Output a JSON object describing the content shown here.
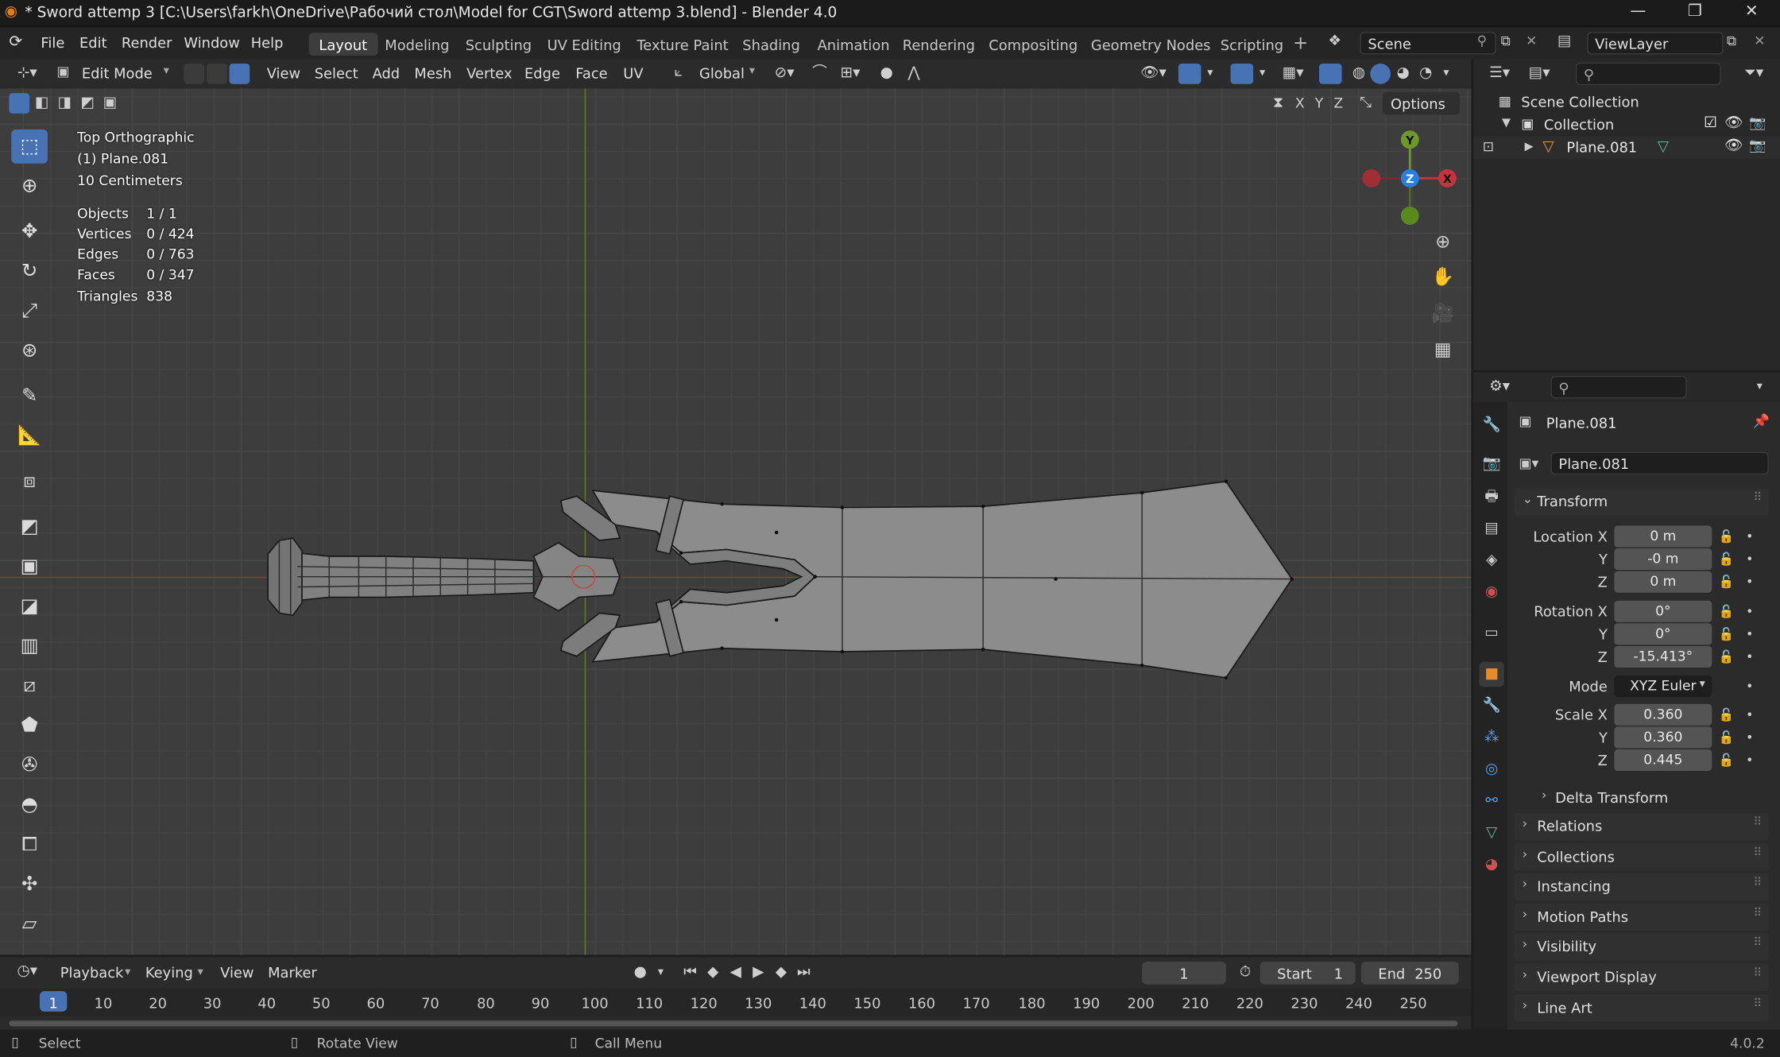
{
  "window": {
    "title": "* Sword attemp 3 [C:\\Users\\farkh\\OneDrive\\Рабочий стол\\Model for CGT\\Sword attemp 3.blend] - Blender 4.0",
    "minimize": "—",
    "maximize": "❐",
    "close": "✕"
  },
  "menu": {
    "items": [
      "File",
      "Edit",
      "Render",
      "Window",
      "Help"
    ]
  },
  "workspaces": [
    "Layout",
    "Modeling",
    "Sculpting",
    "UV Editing",
    "Texture Paint",
    "Shading",
    "Animation",
    "Rendering",
    "Compositing",
    "Geometry Nodes",
    "Scripting"
  ],
  "scene": {
    "name": "Scene",
    "view_layer": "ViewLayer"
  },
  "viewport_header": {
    "mode": "Edit Mode",
    "menus": [
      "View",
      "Select",
      "Add",
      "Mesh",
      "Vertex",
      "Edge",
      "Face",
      "UV"
    ],
    "orientation": "Global",
    "options": "Options",
    "axes": [
      "X",
      "Y",
      "Z"
    ]
  },
  "overlay_info": {
    "view_name": "Top Orthographic",
    "object_name": "(1) Plane.081",
    "scale": "10 Centimeters",
    "stats": [
      {
        "label": "Objects",
        "value": "1 / 1"
      },
      {
        "label": "Vertices",
        "value": "0 / 424"
      },
      {
        "label": "Edges",
        "value": "0 / 763"
      },
      {
        "label": "Faces",
        "value": "0 / 347"
      },
      {
        "label": "Triangles",
        "value": "838"
      }
    ]
  },
  "gizmo": {
    "y": "Y",
    "z": "Z",
    "x": "X"
  },
  "outliner": {
    "scene_collection": "Scene Collection",
    "collection": "Collection",
    "object": "Plane.081"
  },
  "properties": {
    "object_name": "Plane.081",
    "data_name": "Plane.081",
    "transform": {
      "header": "Transform",
      "location_label": "Location X",
      "location": [
        "0 m",
        "-0 m",
        "0 m"
      ],
      "rotation_label": "Rotation X",
      "rotation": [
        "0°",
        "0°",
        "-15.413°"
      ],
      "mode_label": "Mode",
      "mode": "XYZ Euler",
      "scale_label": "Scale X",
      "scale": [
        "0.360",
        "0.360",
        "0.445"
      ],
      "y": "Y",
      "z": "Z"
    },
    "delta": "Delta Transform",
    "panels": [
      "Relations",
      "Collections",
      "Instancing",
      "Motion Paths",
      "Visibility",
      "Viewport Display",
      "Line Art"
    ]
  },
  "timeline": {
    "menus": [
      "Playback",
      "Keying",
      "View",
      "Marker"
    ],
    "current_frame": "1",
    "start_label": "Start",
    "start": "1",
    "end_label": "End",
    "end": "250",
    "ticks": [
      "1",
      "10",
      "20",
      "30",
      "40",
      "50",
      "60",
      "70",
      "80",
      "90",
      "100",
      "110",
      "120",
      "130",
      "140",
      "150",
      "160",
      "170",
      "180",
      "190",
      "200",
      "210",
      "220",
      "230",
      "240",
      "250"
    ]
  },
  "status": {
    "select": "Select",
    "rotate": "Rotate View",
    "menu": "Call Menu",
    "version": "4.0.2"
  },
  "colors": {
    "accent": "#4772b3",
    "x_axis": "#c8323c",
    "y_axis": "#6e9a2a",
    "z_axis": "#2a7ee0",
    "mesh": "#8c8c8c"
  }
}
